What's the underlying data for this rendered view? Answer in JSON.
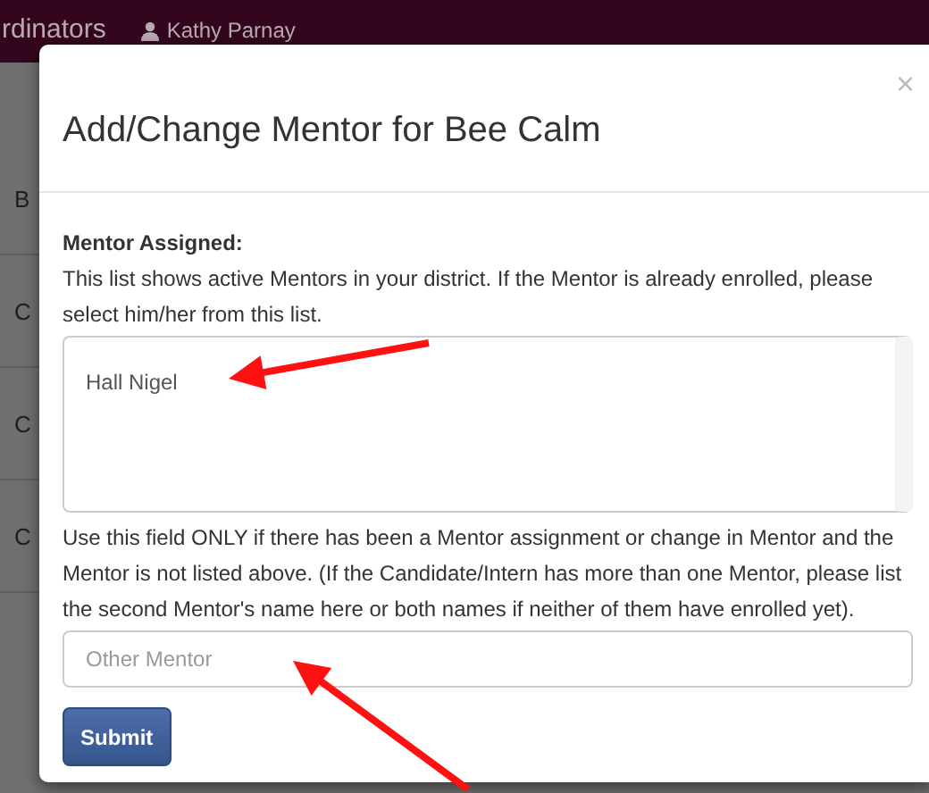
{
  "top_bar": {
    "section_label": "rdinators",
    "user_name": "Kathy Parnay"
  },
  "background_rows": [
    "B",
    "C",
    "C",
    "C"
  ],
  "dialog": {
    "title": "Add/Change Mentor for Bee Calm",
    "close": "×",
    "mentor_label": "Mentor Assigned:",
    "mentor_help": "This list shows active Mentors in your district. If the Mentor is already enrolled, please select him/her from this list.",
    "mentor_list": [
      {
        "name": "Hall Nigel",
        "selected": false
      }
    ],
    "other_help": "Use this field ONLY if there has been a Mentor assignment or change in Mentor and the Mentor is not listed above. (If the Candidate/Intern has more than one Mentor, please list the second Mentor's name here or both names if neither of them have enrolled yet).",
    "other_field": {
      "placeholder": "Other Mentor"
    },
    "submit": "Submit"
  }
}
